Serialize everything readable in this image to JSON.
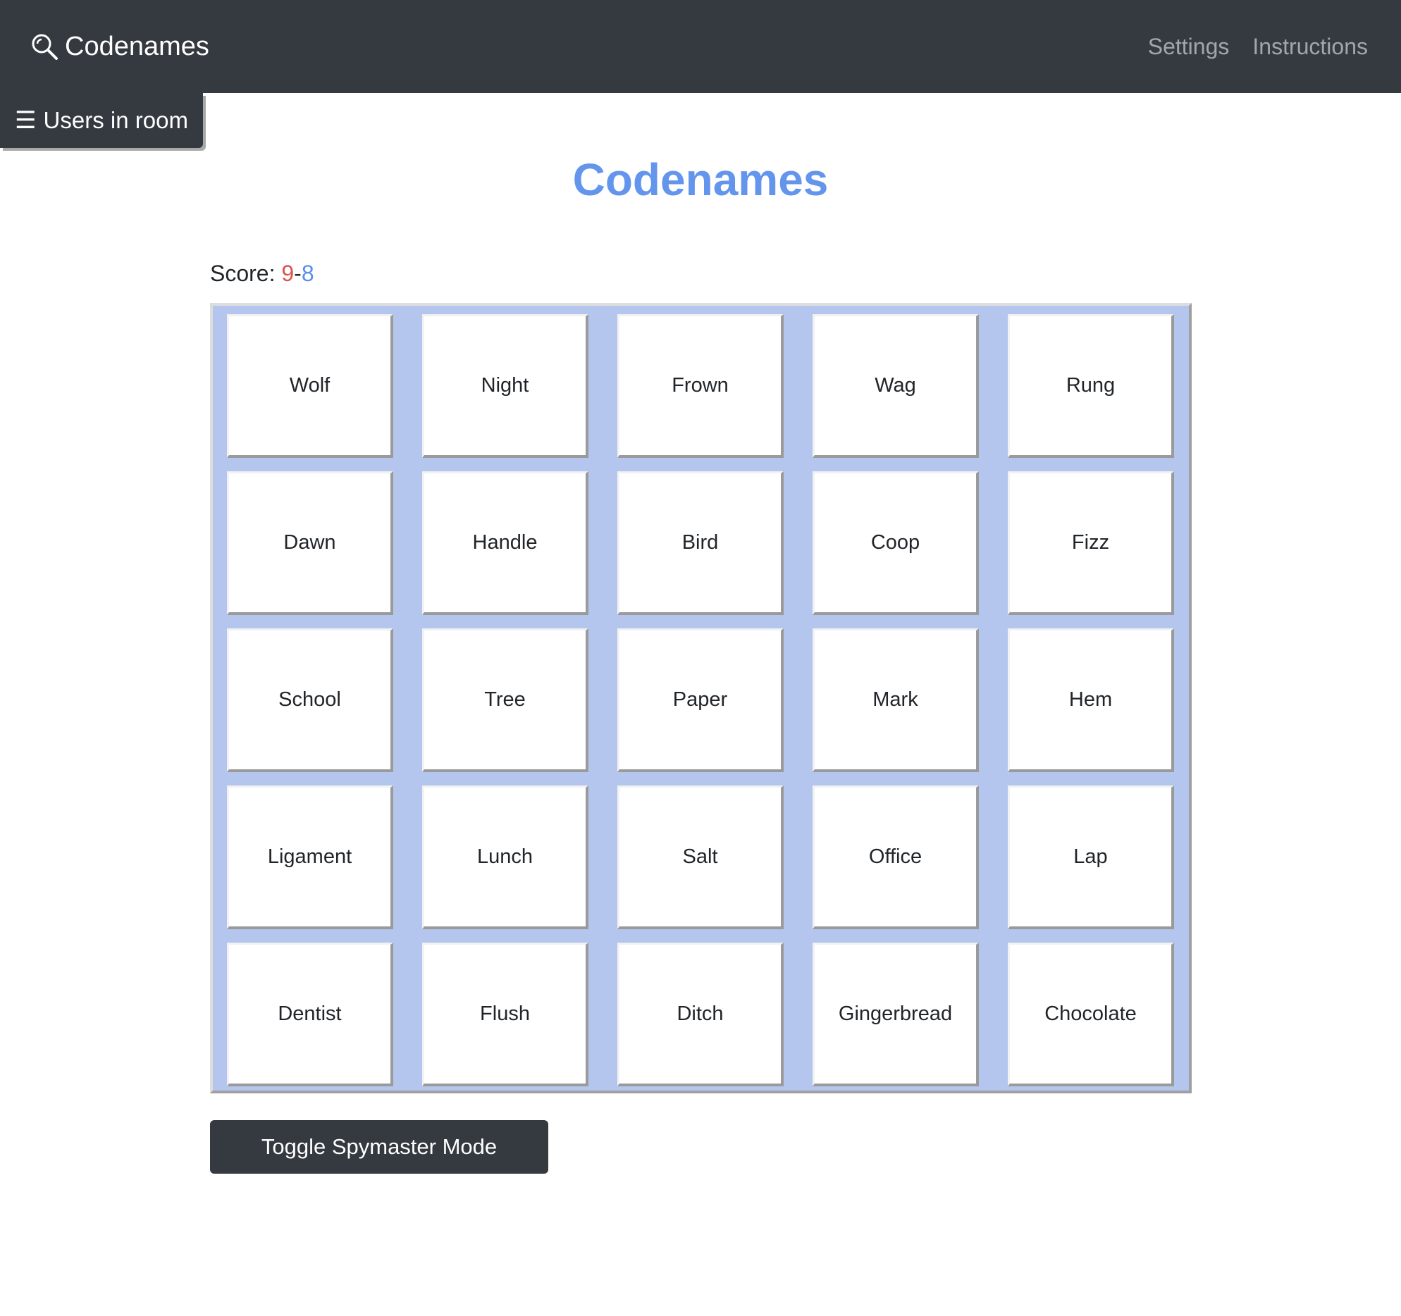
{
  "navbar": {
    "brand_icon": "magnifying-glass-icon",
    "brand_label": "Codenames",
    "links": [
      "Settings",
      "Instructions"
    ]
  },
  "users_button": {
    "icon": "hamburger-menu-icon",
    "label": "Users in room"
  },
  "page": {
    "title": "Codenames"
  },
  "score": {
    "label": "Score:",
    "red": "9",
    "separator": "-",
    "blue": "8",
    "colors": {
      "red": "#d9534f",
      "blue": "#5b8def"
    }
  },
  "board": {
    "background": "#b4c6ee",
    "cards": [
      "Wolf",
      "Night",
      "Frown",
      "Wag",
      "Rung",
      "Dawn",
      "Handle",
      "Bird",
      "Coop",
      "Fizz",
      "School",
      "Tree",
      "Paper",
      "Mark",
      "Hem",
      "Ligament",
      "Lunch",
      "Salt",
      "Office",
      "Lap",
      "Dentist",
      "Flush",
      "Ditch",
      "Gingerbread",
      "Chocolate"
    ]
  },
  "toggle_button": {
    "label": "Toggle Spymaster Mode"
  },
  "colors": {
    "navbar": "#343a40",
    "title": "#6495ed"
  }
}
